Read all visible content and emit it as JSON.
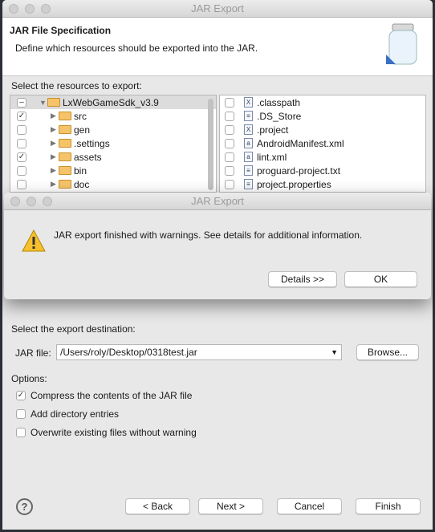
{
  "window": {
    "title": "JAR Export"
  },
  "header": {
    "title": "JAR File Specification",
    "description": "Define which resources should be exported into the JAR.",
    "icon": "jar-icon"
  },
  "resources": {
    "label": "Select the resources to export:",
    "tree": [
      {
        "label": "LxWebGameSdk_v3.9",
        "state": "partial",
        "expanded": true,
        "icon": "project-icon"
      },
      {
        "label": "src",
        "state": "checked",
        "icon": "package-folder-icon"
      },
      {
        "label": "gen",
        "state": "unchecked",
        "icon": "package-folder-icon"
      },
      {
        "label": ".settings",
        "state": "unchecked",
        "icon": "folder-icon"
      },
      {
        "label": "assets",
        "state": "checked",
        "icon": "folder-icon"
      },
      {
        "label": "bin",
        "state": "unchecked",
        "icon": "folder-icon"
      },
      {
        "label": "doc",
        "state": "unchecked",
        "icon": "folder-icon"
      }
    ],
    "files": [
      {
        "label": ".classpath",
        "icon": "xml-file-icon",
        "glyph": "X"
      },
      {
        "label": ".DS_Store",
        "icon": "text-file-icon",
        "glyph": "≡"
      },
      {
        "label": ".project",
        "icon": "xml-file-icon",
        "glyph": "X"
      },
      {
        "label": "AndroidManifest.xml",
        "icon": "android-file-icon",
        "glyph": "a"
      },
      {
        "label": "lint.xml",
        "icon": "android-file-icon",
        "glyph": "a"
      },
      {
        "label": "proguard-project.txt",
        "icon": "text-file-icon",
        "glyph": "≡"
      },
      {
        "label": "project.properties",
        "icon": "text-file-icon",
        "glyph": "≡"
      }
    ]
  },
  "destination": {
    "label": "Select the export destination:",
    "jar_label": "JAR file:",
    "jar_value": "/Users/roly/Desktop/0318test.jar",
    "browse": "Browse..."
  },
  "options": {
    "label": "Options:",
    "items": [
      {
        "label": "Compress the contents of the JAR file",
        "checked": true
      },
      {
        "label": "Add directory entries",
        "checked": false
      },
      {
        "label": "Overwrite existing files without warning",
        "checked": false
      }
    ]
  },
  "footer": {
    "help": "?",
    "back": "< Back",
    "next": "Next >",
    "cancel": "Cancel",
    "finish": "Finish"
  },
  "alert": {
    "title": "JAR Export",
    "message": "JAR export finished with warnings. See details for additional information.",
    "details": "Details >>",
    "ok": "OK"
  }
}
